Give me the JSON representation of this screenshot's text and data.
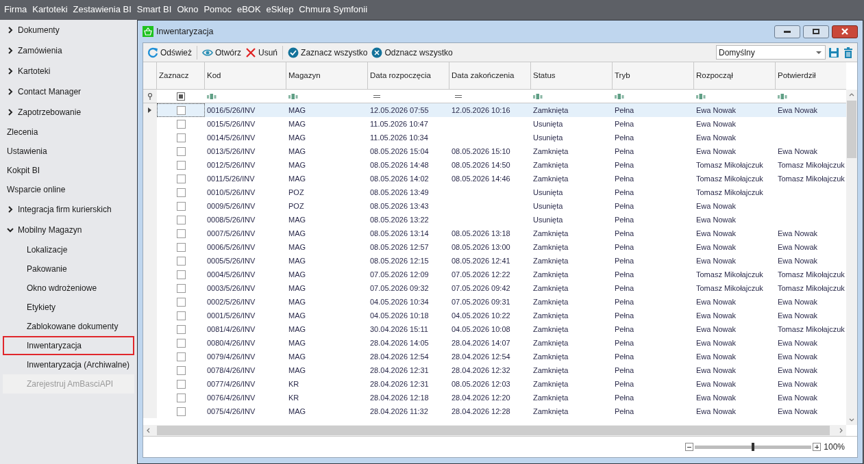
{
  "menu_bar": [
    "Firma",
    "Kartoteki",
    "Zestawienia BI",
    "Smart BI",
    "Okno",
    "Pomoc",
    "eBOK",
    "eSklep",
    "Chmura Symfonii"
  ],
  "sidebar": {
    "items": [
      {
        "kind": "group",
        "label": "Dokumenty",
        "expanded": false,
        "selected": false,
        "disabled": false
      },
      {
        "kind": "group",
        "label": "Zamówienia",
        "expanded": false,
        "selected": false,
        "disabled": false
      },
      {
        "kind": "group",
        "label": "Kartoteki",
        "expanded": false,
        "selected": false,
        "disabled": false
      },
      {
        "kind": "group",
        "label": "Contact Manager",
        "expanded": false,
        "selected": false,
        "disabled": false
      },
      {
        "kind": "group",
        "label": "Zapotrzebowanie",
        "expanded": false,
        "selected": false,
        "disabled": false
      },
      {
        "kind": "link",
        "label": "Zlecenia",
        "selected": false,
        "disabled": false
      },
      {
        "kind": "link",
        "label": "Ustawienia",
        "selected": false,
        "disabled": false
      },
      {
        "kind": "link",
        "label": "Kokpit BI",
        "selected": false,
        "disabled": false
      },
      {
        "kind": "link",
        "label": "Wsparcie online",
        "selected": false,
        "disabled": false
      },
      {
        "kind": "group",
        "label": "Integracja firm kurierskich",
        "expanded": false,
        "selected": false,
        "disabled": false
      },
      {
        "kind": "group",
        "label": "Mobilny Magazyn",
        "expanded": true,
        "selected": false,
        "disabled": false,
        "children": [
          {
            "label": "Lokalizacje",
            "selected": false,
            "disabled": false
          },
          {
            "label": "Pakowanie",
            "selected": false,
            "disabled": false
          },
          {
            "label": "Okno wdrożeniowe",
            "selected": false,
            "disabled": false
          },
          {
            "label": "Etykiety",
            "selected": false,
            "disabled": false
          },
          {
            "label": "Zablokowane dokumenty",
            "selected": false,
            "disabled": false
          },
          {
            "label": "Inwentaryzacja",
            "selected": true,
            "disabled": false
          },
          {
            "label": "Inwentaryzacja (Archiwalne)",
            "selected": false,
            "disabled": false
          },
          {
            "label": "Zarejestruj AmBasciAPI",
            "selected": false,
            "disabled": true
          }
        ]
      }
    ]
  },
  "window": {
    "title": "Inwentaryzacja"
  },
  "toolbar": {
    "groups": [
      [
        {
          "kind": "refresh",
          "label": "Odśwież"
        }
      ],
      [
        {
          "kind": "open",
          "label": "Otwórz"
        },
        {
          "kind": "delete",
          "label": "Usuń"
        }
      ],
      [
        {
          "kind": "select_all",
          "label": "Zaznacz wszystko"
        },
        {
          "kind": "deselect_all",
          "label": "Odznacz wszystko"
        }
      ]
    ],
    "layout_dropdown": {
      "value": "Domyślny"
    }
  },
  "table": {
    "columns": [
      {
        "label": "Zaznacz",
        "kind": "check"
      },
      {
        "label": "Kod",
        "kind": "text"
      },
      {
        "label": "Magazyn",
        "kind": "text"
      },
      {
        "label": "Data rozpoczęcia",
        "kind": "date"
      },
      {
        "label": "Data zakończenia",
        "kind": "date"
      },
      {
        "label": "Status",
        "kind": "text"
      },
      {
        "label": "Tryb",
        "kind": "text"
      },
      {
        "label": "Rozpoczął",
        "kind": "text"
      },
      {
        "label": "Potwierdził",
        "kind": "text"
      }
    ],
    "rows": [
      {
        "selected": true,
        "checked": false,
        "code": "0016/5/26/INV",
        "warehouse": "MAG",
        "start": "12.05.2026 07:55",
        "end": "12.05.2026 10:16",
        "status": "Zamknięta",
        "mode": "Pełna",
        "started_by": "Ewa Nowak",
        "confirmed_by": "Ewa Nowak"
      },
      {
        "selected": false,
        "checked": false,
        "code": "0015/5/26/INV",
        "warehouse": "MAG",
        "start": "11.05.2026 10:47",
        "status": "Usunięta",
        "mode": "Pełna",
        "started_by": "Ewa Nowak"
      },
      {
        "selected": false,
        "checked": false,
        "code": "0014/5/26/INV",
        "warehouse": "MAG",
        "start": "11.05.2026 10:34",
        "status": "Usunięta",
        "mode": "Pełna",
        "started_by": "Ewa Nowak"
      },
      {
        "selected": false,
        "checked": false,
        "code": "0013/5/26/INV",
        "warehouse": "MAG",
        "start": "08.05.2026 15:04",
        "end": "08.05.2026 15:10",
        "status": "Zamknięta",
        "mode": "Pełna",
        "started_by": "Ewa Nowak",
        "confirmed_by": "Ewa Nowak"
      },
      {
        "selected": false,
        "checked": false,
        "code": "0012/5/26/INV",
        "warehouse": "MAG",
        "start": "08.05.2026 14:48",
        "end": "08.05.2026 14:50",
        "status": "Zamknięta",
        "mode": "Pełna",
        "started_by": "Tomasz Mikołajczuk",
        "confirmed_by": "Tomasz Mikołajczuk"
      },
      {
        "selected": false,
        "checked": false,
        "code": "0011/5/26/INV",
        "warehouse": "MAG",
        "start": "08.05.2026 14:02",
        "end": "08.05.2026 14:46",
        "status": "Zamknięta",
        "mode": "Pełna",
        "started_by": "Tomasz Mikołajczuk",
        "confirmed_by": "Tomasz Mikołajczuk"
      },
      {
        "selected": false,
        "checked": false,
        "code": "0010/5/26/INV",
        "warehouse": "POZ",
        "start": "08.05.2026 13:49",
        "status": "Usunięta",
        "mode": "Pełna",
        "started_by": "Tomasz Mikołajczuk"
      },
      {
        "selected": false,
        "checked": false,
        "code": "0009/5/26/INV",
        "warehouse": "POZ",
        "start": "08.05.2026 13:43",
        "status": "Usunięta",
        "mode": "Pełna",
        "started_by": "Ewa Nowak"
      },
      {
        "selected": false,
        "checked": false,
        "code": "0008/5/26/INV",
        "warehouse": "MAG",
        "start": "08.05.2026 13:22",
        "status": "Usunięta",
        "mode": "Pełna",
        "started_by": "Ewa Nowak"
      },
      {
        "selected": false,
        "checked": false,
        "code": "0007/5/26/INV",
        "warehouse": "MAG",
        "start": "08.05.2026 13:14",
        "end": "08.05.2026 13:18",
        "status": "Zamknięta",
        "mode": "Pełna",
        "started_by": "Ewa Nowak",
        "confirmed_by": "Ewa Nowak"
      },
      {
        "selected": false,
        "checked": false,
        "code": "0006/5/26/INV",
        "warehouse": "MAG",
        "start": "08.05.2026 12:57",
        "end": "08.05.2026 13:00",
        "status": "Zamknięta",
        "mode": "Pełna",
        "started_by": "Ewa Nowak",
        "confirmed_by": "Ewa Nowak"
      },
      {
        "selected": false,
        "checked": false,
        "code": "0005/5/26/INV",
        "warehouse": "MAG",
        "start": "08.05.2026 12:15",
        "end": "08.05.2026 12:41",
        "status": "Zamknięta",
        "mode": "Pełna",
        "started_by": "Ewa Nowak",
        "confirmed_by": "Ewa Nowak"
      },
      {
        "selected": false,
        "checked": false,
        "code": "0004/5/26/INV",
        "warehouse": "MAG",
        "start": "07.05.2026 12:09",
        "end": "07.05.2026 12:22",
        "status": "Zamknięta",
        "mode": "Pełna",
        "started_by": "Tomasz Mikołajczuk",
        "confirmed_by": "Tomasz Mikołajczuk"
      },
      {
        "selected": false,
        "checked": false,
        "code": "0003/5/26/INV",
        "warehouse": "MAG",
        "start": "07.05.2026 09:32",
        "end": "07.05.2026 09:42",
        "status": "Zamknięta",
        "mode": "Pełna",
        "started_by": "Tomasz Mikołajczuk",
        "confirmed_by": "Tomasz Mikołajczuk"
      },
      {
        "selected": false,
        "checked": false,
        "code": "0002/5/26/INV",
        "warehouse": "MAG",
        "start": "04.05.2026 10:34",
        "end": "07.05.2026 09:31",
        "status": "Zamknięta",
        "mode": "Pełna",
        "started_by": "Ewa Nowak",
        "confirmed_by": "Ewa Nowak"
      },
      {
        "selected": false,
        "checked": false,
        "code": "0001/5/26/INV",
        "warehouse": "MAG",
        "start": "04.05.2026 10:18",
        "end": "04.05.2026 10:22",
        "status": "Zamknięta",
        "mode": "Pełna",
        "started_by": "Ewa Nowak",
        "confirmed_by": "Ewa Nowak"
      },
      {
        "selected": false,
        "checked": false,
        "code": "0081/4/26/INV",
        "warehouse": "MAG",
        "start": "30.04.2026 15:11",
        "end": "04.05.2026 10:08",
        "status": "Zamknięta",
        "mode": "Pełna",
        "started_by": "Ewa Nowak",
        "confirmed_by": "Tomasz Mikołajczuk"
      },
      {
        "selected": false,
        "checked": false,
        "code": "0080/4/26/INV",
        "warehouse": "MAG",
        "start": "28.04.2026 14:05",
        "end": "28.04.2026 14:07",
        "status": "Zamknięta",
        "mode": "Pełna",
        "started_by": "Ewa Nowak",
        "confirmed_by": "Ewa Nowak"
      },
      {
        "selected": false,
        "checked": false,
        "code": "0079/4/26/INV",
        "warehouse": "MAG",
        "start": "28.04.2026 12:54",
        "end": "28.04.2026 12:54",
        "status": "Zamknięta",
        "mode": "Pełna",
        "started_by": "Ewa Nowak",
        "confirmed_by": "Ewa Nowak"
      },
      {
        "selected": false,
        "checked": false,
        "code": "0078/4/26/INV",
        "warehouse": "MAG",
        "start": "28.04.2026 12:31",
        "end": "28.04.2026 12:32",
        "status": "Zamknięta",
        "mode": "Pełna",
        "started_by": "Ewa Nowak",
        "confirmed_by": "Ewa Nowak"
      },
      {
        "selected": false,
        "checked": false,
        "code": "0077/4/26/INV",
        "warehouse": "KR",
        "start": "28.04.2026 12:31",
        "end": "08.05.2026 12:03",
        "status": "Zamknięta",
        "mode": "Pełna",
        "started_by": "Ewa Nowak",
        "confirmed_by": "Ewa Nowak"
      },
      {
        "selected": false,
        "checked": false,
        "code": "0076/4/26/INV",
        "warehouse": "KR",
        "start": "28.04.2026 12:18",
        "end": "28.04.2026 12:20",
        "status": "Zamknięta",
        "mode": "Pełna",
        "started_by": "Ewa Nowak",
        "confirmed_by": "Ewa Nowak"
      },
      {
        "selected": false,
        "checked": false,
        "code": "0075/4/26/INV",
        "warehouse": "MAG",
        "start": "28.04.2026 11:32",
        "end": "28.04.2026 12:28",
        "status": "Zamknięta",
        "mode": "Pełna",
        "started_by": "Ewa Nowak",
        "confirmed_by": "Ewa Nowak"
      }
    ]
  },
  "zoom": {
    "level": 0.5,
    "reading": "100%"
  }
}
